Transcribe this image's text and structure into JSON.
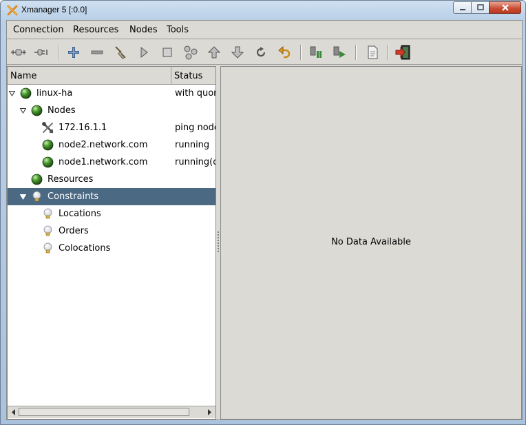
{
  "window": {
    "title": "Xmanager 5 [:0.0]"
  },
  "menu": [
    "Connection",
    "Resources",
    "Nodes",
    "Tools"
  ],
  "toolbar": {
    "buttons": [
      "connect-icon",
      "disconnect-icon",
      "add-icon",
      "remove-icon",
      "cleanup-icon",
      "start-icon",
      "stop-icon",
      "migrate-icon",
      "move-up-icon",
      "move-down-icon",
      "refresh-icon",
      "undo-icon",
      "standby-icon",
      "active-icon",
      "log-icon",
      "exit-icon"
    ]
  },
  "tree": {
    "columns": {
      "name": "Name",
      "status": "Status"
    },
    "rows": [
      {
        "label": "linux-ha",
        "status": "with quorum",
        "icon": "green-ball-icon",
        "level": 0,
        "expander": "expanded"
      },
      {
        "label": "Nodes",
        "status": "",
        "icon": "green-ball-icon",
        "level": 1,
        "expander": "expanded"
      },
      {
        "label": "172.16.1.1",
        "status": "ping node",
        "icon": "tools-icon",
        "level": 2,
        "expander": "none"
      },
      {
        "label": "node2.network.com",
        "status": "running",
        "icon": "green-ball-icon",
        "level": 2,
        "expander": "none"
      },
      {
        "label": "node1.network.com",
        "status": "running(dc)",
        "icon": "green-ball-icon",
        "level": 2,
        "expander": "none"
      },
      {
        "label": "Resources",
        "status": "",
        "icon": "green-ball-icon",
        "level": 1,
        "expander": "none"
      },
      {
        "label": "Constraints",
        "status": "",
        "icon": "bulb-icon",
        "level": 1,
        "expander": "expanded",
        "selected": true
      },
      {
        "label": "Locations",
        "status": "",
        "icon": "bulb-icon",
        "level": 2,
        "expander": "none"
      },
      {
        "label": "Orders",
        "status": "",
        "icon": "bulb-icon",
        "level": 2,
        "expander": "none"
      },
      {
        "label": "Colocations",
        "status": "",
        "icon": "bulb-icon",
        "level": 2,
        "expander": "none"
      }
    ]
  },
  "detail": {
    "message": "No Data Available"
  }
}
